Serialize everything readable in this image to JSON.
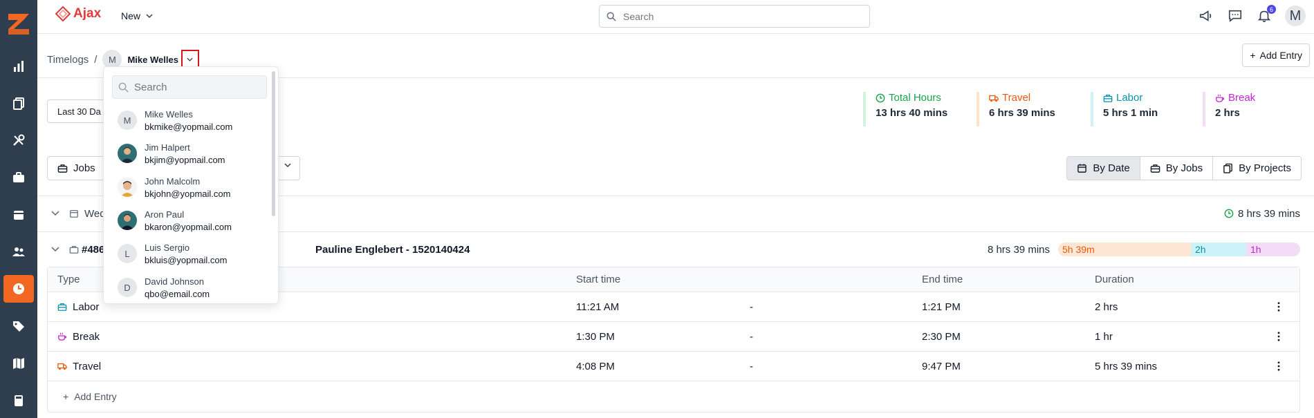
{
  "brand": {
    "name": "Ajax"
  },
  "topbar": {
    "new_label": "New",
    "search_placeholder": "Search",
    "notification_count": "6",
    "user_initial": "M"
  },
  "breadcrumb": {
    "root": "Timelogs",
    "separator": "/",
    "user_initial": "M",
    "user_name": "Mike Welles"
  },
  "add_entry_label": "Add Entry",
  "date_filter": {
    "label": "Last 30 Da"
  },
  "stats": [
    {
      "label": "Total Hours",
      "value": "13 hrs 40 mins",
      "color": "#16a34a"
    },
    {
      "label": "Travel",
      "value": "6 hrs 39 mins",
      "color": "#ea580c"
    },
    {
      "label": "Labor",
      "value": "5 hrs 1 min",
      "color": "#0891b2"
    },
    {
      "label": "Break",
      "value": "2 hrs",
      "color": "#c026d3"
    }
  ],
  "filter": {
    "jobs_label": "Jobs"
  },
  "view_tabs": [
    {
      "label": "By Date",
      "active": true
    },
    {
      "label": "By Jobs",
      "active": false
    },
    {
      "label": "By Projects",
      "active": false
    }
  ],
  "week_group": {
    "title": "Wed",
    "total": "8 hrs 39 mins"
  },
  "job_group": {
    "title": "#486",
    "client": "Pauline Englebert - 1520140424",
    "total": "8 hrs 39 mins",
    "bar": {
      "travel": "5h 39m",
      "labor": "2h",
      "break": "1h"
    }
  },
  "table": {
    "columns": [
      "Type",
      "Start time",
      "End time",
      "Duration"
    ],
    "rows": [
      {
        "type": "Labor",
        "start": "11:21 AM",
        "dash": "-",
        "end": "1:21 PM",
        "duration": "2 hrs"
      },
      {
        "type": "Break",
        "start": "1:30 PM",
        "dash": "-",
        "end": "2:30 PM",
        "duration": "1 hr"
      },
      {
        "type": "Travel",
        "start": "4:08 PM",
        "dash": "-",
        "end": "9:47 PM",
        "duration": "5 hrs 39 mins"
      }
    ],
    "add_label": "Add Entry"
  },
  "user_dropdown": {
    "search_placeholder": "Search",
    "users": [
      {
        "name": "Mike Welles",
        "email": "bkmike@yopmail.com",
        "initial": "M",
        "photo": false
      },
      {
        "name": "Jim Halpert",
        "email": "bkjim@yopmail.com",
        "initial": "",
        "photo": true
      },
      {
        "name": "John Malcolm",
        "email": "bkjohn@yopmail.com",
        "initial": "",
        "photo": true
      },
      {
        "name": "Aron Paul",
        "email": "bkaron@yopmail.com",
        "initial": "",
        "photo": true
      },
      {
        "name": "Luis Sergio",
        "email": "bkluis@yopmail.com",
        "initial": "L",
        "photo": false
      },
      {
        "name": "David Johnson",
        "email": "qbo@email.com",
        "initial": "D",
        "photo": false
      }
    ]
  },
  "colors": {
    "sidebar_bg": "#2f3e4e",
    "accent": "#f26722",
    "highlight_box": "#d31616"
  }
}
